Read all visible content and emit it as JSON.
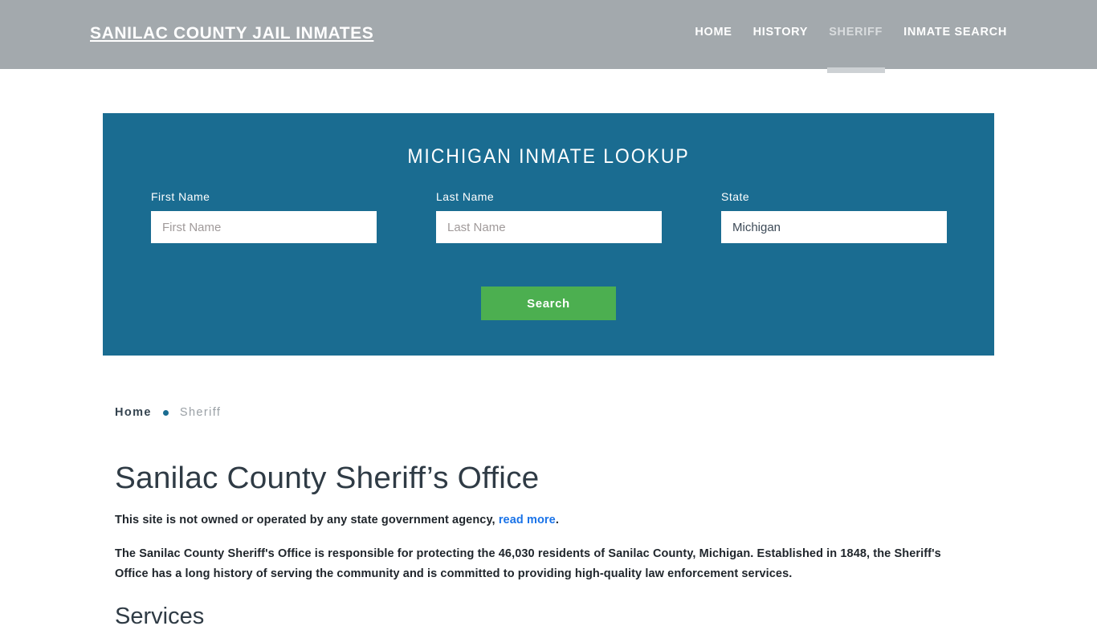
{
  "header": {
    "site_title": "SANILAC COUNTY JAIL INMATES",
    "nav": [
      {
        "label": "HOME",
        "active": false
      },
      {
        "label": "HISTORY",
        "active": false
      },
      {
        "label": "SHERIFF",
        "active": true
      },
      {
        "label": "INMATE SEARCH",
        "active": false
      }
    ],
    "background_color": "#a3a9ad"
  },
  "search_panel": {
    "heading": "MICHIGAN INMATE LOOKUP",
    "background_color": "#1a6c91",
    "first_name": {
      "label": "First Name",
      "placeholder": "First Name",
      "value": ""
    },
    "last_name": {
      "label": "Last Name",
      "placeholder": "Last Name",
      "value": ""
    },
    "state": {
      "label": "State",
      "value": "Michigan"
    },
    "submit_label": "Search",
    "submit_color": "#4caf50"
  },
  "breadcrumb": {
    "home": "Home",
    "separator": "•",
    "current": "Sheriff"
  },
  "article": {
    "title": "Sanilac County Sheriff’s Office",
    "disclaimer_text": "This site is not owned or operated by any state government agency,",
    "disclaimer_link": "read more",
    "disclaimer_end": ".",
    "link_color": "#1a73e8",
    "paragraph": "The Sanilac County Sheriff's Office is responsible for protecting the 46,030 residents of Sanilac County, Michigan. Established in 1848, the Sheriff's Office has a long history of serving the community and is committed to providing high-quality law enforcement services.",
    "section_heading": "Services"
  }
}
